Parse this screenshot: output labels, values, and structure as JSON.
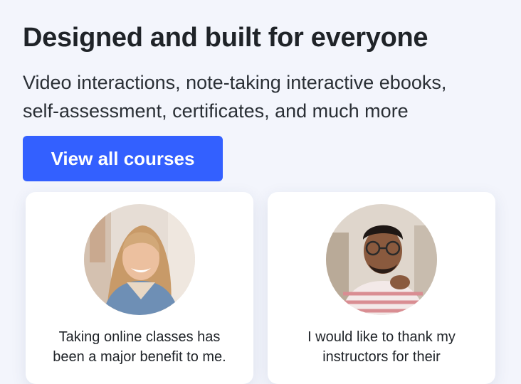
{
  "hero": {
    "title": "Designed and built for everyone",
    "subtitle_line1": "Video interactions, note-taking interactive ebooks,",
    "subtitle_line2": "self-assessment, certificates, and much more",
    "cta_label": "View all courses"
  },
  "testimonials": [
    {
      "quote_line1": "Taking online classes has",
      "quote_line2": "been a major benefit to me."
    },
    {
      "quote_line1": "I would like to thank my",
      "quote_line2": "instructors for their"
    }
  ],
  "colors": {
    "background": "#f3f5fc",
    "accent": "#3360ff",
    "text": "#1f2328",
    "card": "#ffffff"
  }
}
